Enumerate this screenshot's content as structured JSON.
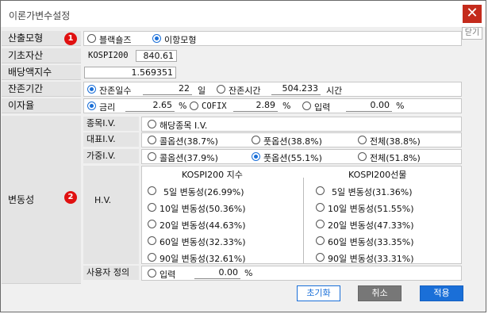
{
  "window": {
    "title": "이론가변수설정"
  },
  "hide_label": "닫기",
  "badges": {
    "b1": "1",
    "b2": "2"
  },
  "calc_model": {
    "label": "산출모형",
    "options": [
      "블랙숄즈",
      "이항모형"
    ],
    "selected": "이항모형"
  },
  "underlying": {
    "label": "기초자산",
    "name": "KOSPI200",
    "value": "840.61"
  },
  "dividend": {
    "label": "배당액지수",
    "value": "1.569351"
  },
  "remaining": {
    "label": "잔존기간",
    "option1": "잔존일수",
    "days": "22",
    "days_unit": "일",
    "option2": "잔존시간",
    "hours": "504.233",
    "hours_unit": "시간"
  },
  "interest": {
    "label": "이자율",
    "opt1": "금리",
    "val1": "2.65",
    "unit1": "%",
    "opt2": "COFIX",
    "val2": "2.89",
    "unit2": "%",
    "opt3": "입력",
    "val3": "0.00",
    "unit3": "%"
  },
  "volatility": {
    "label": "변동성",
    "item_iv": {
      "label": "종목I.V.",
      "opt": "해당종목 I.V."
    },
    "rep_iv": {
      "label": "대표I.V.",
      "opts": [
        "콜옵션(38.7%)",
        "풋옵션(38.8%)",
        "전체(38.8%)"
      ]
    },
    "wgt_iv": {
      "label": "가중I.V.",
      "opts": [
        "콜옵션(37.9%)",
        "풋옵션(55.1%)",
        "전체(51.8%)"
      ]
    },
    "hv": {
      "label": "H.V.",
      "col1_title": "KOSPI200 지수",
      "col2_title": "KOSPI200선물",
      "col1": [
        "5일 변동성(26.99%)",
        "10일 변동성(50.36%)",
        "20일 변동성(44.63%)",
        "60일 변동성(32.33%)",
        "90일 변동성(32.61%)"
      ],
      "col2": [
        "5일 변동성(31.36%)",
        "10일 변동성(51.55%)",
        "20일 변동성(47.33%)",
        "60일 변동성(33.35%)",
        "90일 변동성(33.31%)"
      ]
    },
    "user": {
      "label": "사용자 정의",
      "opt": "입력",
      "value": "0.00",
      "unit": "%"
    }
  },
  "buttons": {
    "reset": "초기화",
    "cancel": "취소",
    "apply": "적용"
  },
  "colors": {
    "accent": "#1a6fd8",
    "close": "#c42b1c",
    "badge": "#e01010"
  }
}
